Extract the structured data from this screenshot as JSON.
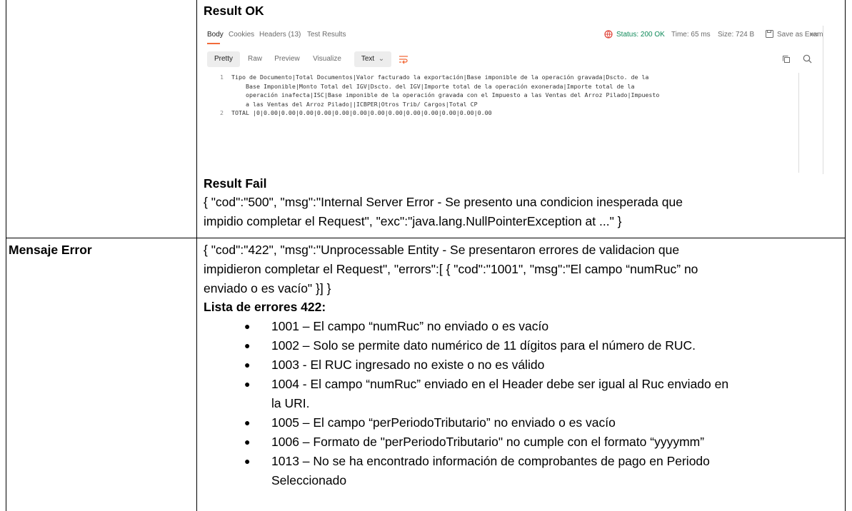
{
  "result_ok": {
    "heading": "Result OK",
    "postman": {
      "tabs": [
        "Body",
        "Cookies",
        "Headers (13)",
        "Test Results"
      ],
      "status": "Status: 200 OK",
      "time": "Time: 65 ms",
      "size": "Size: 724 B",
      "save_label": "Save as Example",
      "more": "ooo",
      "view_buttons": [
        "Pretty",
        "Raw",
        "Preview",
        "Visualize"
      ],
      "format_select": "Text",
      "code_lines": [
        {
          "num": "1",
          "text": "Tipo de Documento|Total Documentos|Valor facturado la exportación|Base imponible de la operación gravada|Dscto. de la"
        },
        {
          "num": "",
          "text": "    Base Imponible|Monto Total del IGV|Dscto. del IGV|Importe total de la operación exonerada|Importe total de la"
        },
        {
          "num": "",
          "text": "    operación inafecta|ISC|Base imponible de la operación gravada con el Impuesto a las Ventas del Arroz Pilado|Impuesto"
        },
        {
          "num": "",
          "text": "    a las Ventas del Arroz Pilado||ICBPER|Otros Trib/ Cargos|Total CP"
        },
        {
          "num": "2",
          "text": "TOTAL |0|0.00|0.00|0.00|0.00|0.00|0.00|0.00|0.00|0.00|0.00|0.00|0.00|0.00"
        }
      ]
    }
  },
  "result_fail": {
    "heading": "Result Fail",
    "lines": [
      "{ \"cod\":\"500\", \"msg\":\"Internal Server Error - Se presento una condicion inesperada que",
      "impidio completar el Request\", \"exc\":\"java.lang.NullPointerException at ...\" }"
    ]
  },
  "mensaje_error": {
    "label": "Mensaje Error",
    "lines": [
      "{ \"cod\":\"422\", \"msg\":\"Unprocessable Entity - Se presentaron errores de validacion que",
      "impidieron completar el Request\", \"errors\":[ { \"cod\":\"1001\", \"msg\":\"El campo “numRuc” no",
      "enviado o es vacío\" }] }"
    ],
    "list_heading": "Lista de errores 422:",
    "bullet": "●",
    "errors": [
      "1001 – El campo “numRuc” no enviado o es vacío",
      "1002 – Solo se permite dato numérico de 11 dígitos para el número de RUC.",
      "1003 - El RUC ingresado no existe o no es válido",
      "1004 - El campo “numRuc” enviado en el Header debe ser igual al Ruc enviado en",
      "la URI.",
      "1005 – El campo “perPeriodoTributario” no enviado o es vacío",
      "1006 – Formato de \"perPeriodoTributario\" no cumple con el formato “yyyymm”",
      "1013 – No se ha encontrado información de comprobantes de pago en Periodo",
      "Seleccionado"
    ]
  }
}
